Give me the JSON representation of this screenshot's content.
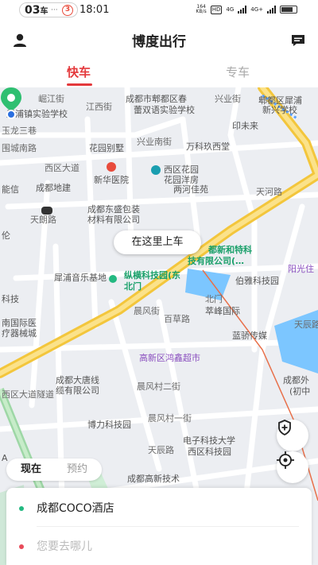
{
  "status_bar": {
    "carrier_badge": "03",
    "carrier_char": "车",
    "dots": "···",
    "notif_count": "3",
    "time": "18:01",
    "net_speed": "164",
    "net_unit": "KB/s",
    "hd": "HD",
    "sig1": "4G",
    "sig2": "4G+"
  },
  "app": {
    "title": "博度出行",
    "profile_icon": "person-icon",
    "message_icon": "message-icon"
  },
  "tabs": [
    {
      "label": "快车",
      "active": true
    },
    {
      "label": "专车",
      "active": false
    }
  ],
  "map": {
    "labels": {
      "l1": "犀浦镇实验学校",
      "l2": "崛江街",
      "l3": "江西街",
      "l4": "成都市郫都区春",
      "l5": "蕾双语实验学校",
      "l6": "兴业街",
      "l7": "郫都区犀浦",
      "l8": "新兴学校",
      "l9": "印未来",
      "l10": "玉龙三巷",
      "l11": "围城南路",
      "l12": "花园别墅",
      "l13": "兴业南街",
      "l14": "万科玖西堂",
      "l15": "西区大道",
      "l16": "新华医院",
      "l17": "西区花园",
      "l18": "花园洋房",
      "l19": "能信",
      "l20": "成都地建",
      "l21": "两河佳苑",
      "l22": "天河路",
      "l23": "天朗路",
      "l24": "成都东盛包装",
      "l25": "材料有限公司",
      "l26": "伦",
      "l27": "都新和特科",
      "l28": "技有限公司(…",
      "l29": "阳光住",
      "l30": "犀浦音乐基地",
      "l31": "纵横科技园(东",
      "l32": "北门",
      "l33": "伯雅科技园",
      "l34": "科技",
      "l35": "南国际医",
      "l36": "疗器械城",
      "l37": "晨风街",
      "l38": "百草路",
      "l39": "萃峰国际",
      "l40": "蓝骄传媒",
      "l41": "天辰路",
      "l42": "高新区鸿鑫超市",
      "l43": "成都外",
      "l44": "(初中",
      "l45": "西区大道隧道",
      "l46": "成都大唐线",
      "l47": "缆有限公司",
      "l48": "晨风村二街",
      "l49": "晨风村一街",
      "l50": "博力科技园",
      "l51": "天辰路",
      "l52": "电子科技大学",
      "l53": "西区科技园",
      "l54": "成都高新技术",
      "l55": "A",
      "l56": "北门"
    },
    "pickup_label": "在这里上车"
  },
  "controls": {
    "safety_icon": "shield-plus-icon",
    "locate_icon": "locate-crosshair-icon"
  },
  "time_toggle": {
    "now": "现在",
    "later": "预约"
  },
  "addresses": {
    "from": "成都COCO酒店",
    "to_placeholder": "您要去哪儿"
  },
  "colors": {
    "accent": "#e4393c",
    "from_dot": "#23b981",
    "to_dot": "#e84b5a",
    "main_road": "#f7cf4a",
    "pickup_pin": "#2fbf71",
    "water": "#7cc6ff"
  }
}
